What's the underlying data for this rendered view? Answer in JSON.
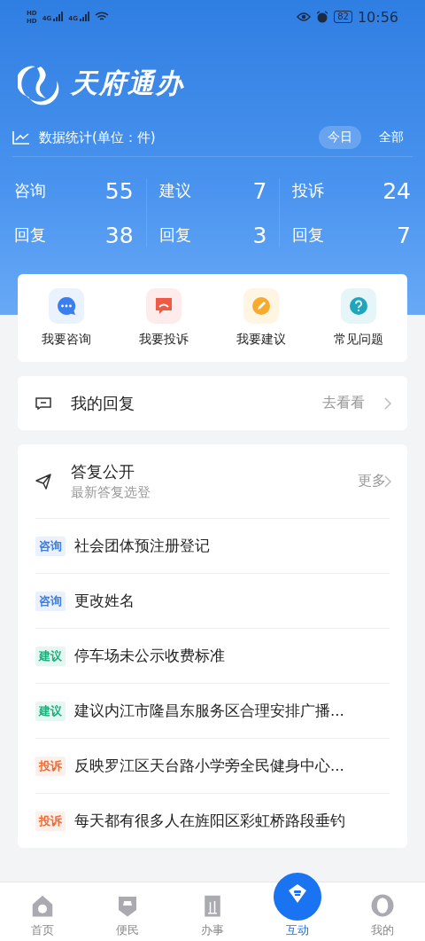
{
  "status_bar": {
    "left": [
      "HD",
      "HD",
      "4G",
      "4G"
    ],
    "battery": "82",
    "time": "10:56"
  },
  "header": {
    "logo_text": "天府通办"
  },
  "stats": {
    "title": "数据统计(单位：件)",
    "tabs": [
      {
        "label": "今日",
        "selected": true
      },
      {
        "label": "全部",
        "selected": false
      }
    ],
    "columns": [
      {
        "label": "咨询",
        "value": "55",
        "reply_label": "回复",
        "reply_value": "38"
      },
      {
        "label": "建议",
        "value": "7",
        "reply_label": "回复",
        "reply_value": "3"
      },
      {
        "label": "投诉",
        "value": "24",
        "reply_label": "回复",
        "reply_value": "7"
      }
    ]
  },
  "actions": [
    {
      "kind": "consult",
      "label": "我要咨询"
    },
    {
      "kind": "complain",
      "label": "我要投诉"
    },
    {
      "kind": "suggest",
      "label": "我要建议"
    },
    {
      "kind": "faq",
      "label": "常见问题"
    }
  ],
  "my_reply": {
    "title": "我的回复",
    "link": "去看看"
  },
  "public": {
    "title": "答复公开",
    "subtitle": "最新答复选登",
    "more": "更多",
    "items": [
      {
        "tag": "咨询",
        "color": "#3d7fe0",
        "text": "社会团体预注册登记"
      },
      {
        "tag": "咨询",
        "color": "#3d7fe0",
        "text": "更改姓名"
      },
      {
        "tag": "建议",
        "color": "#17b07a",
        "text": "停车场未公示收费标准"
      },
      {
        "tag": "建议",
        "color": "#17b07a",
        "text": "建议内江市隆昌东服务区合理安排广播..."
      },
      {
        "tag": "投诉",
        "color": "#ef6a34",
        "text": "反映罗江区天台路小学旁全民健身中心..."
      },
      {
        "tag": "投诉",
        "color": "#ef6a34",
        "text": "每天都有很多人在旌阳区彩虹桥路段垂钓"
      }
    ]
  },
  "tab_bar": [
    {
      "label": "首页",
      "selected": false
    },
    {
      "label": "便民",
      "selected": false
    },
    {
      "label": "办事",
      "selected": false
    },
    {
      "label": "互动",
      "selected": true
    },
    {
      "label": "我的",
      "selected": false
    }
  ]
}
